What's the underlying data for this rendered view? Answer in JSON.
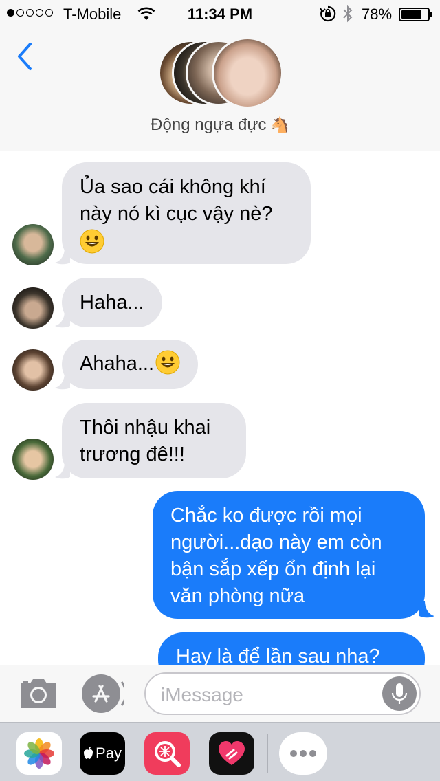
{
  "status_bar": {
    "carrier": "T-Mobile",
    "time": "11:34 PM",
    "battery": "78%",
    "signal_bars": 1,
    "battery_level": 0.78
  },
  "header": {
    "group_name": "Động ngựa đực",
    "group_emoji": "🐴"
  },
  "messages": [
    {
      "direction": "incoming",
      "text": "Ủa sao cái không khí\nnày nó kì cục vậy nè?",
      "emoji": "smiling-face"
    },
    {
      "direction": "incoming",
      "text": "Haha..."
    },
    {
      "direction": "incoming",
      "text": "Ahaha...",
      "emoji": "smiling-face"
    },
    {
      "direction": "incoming",
      "text": "Thôi nhậu khai\ntrương đê!!!"
    },
    {
      "direction": "outgoing",
      "text": "Chắc ko được rồi mọi\nngười...dạo này em còn\nbận sắp xếp ổn định lại\nvăn phòng nữa"
    },
    {
      "direction": "outgoing",
      "text": "Hay là để lần sau nha?"
    }
  ],
  "input": {
    "placeholder": "iMessage"
  },
  "app_drawer": {
    "apple_pay_label": "Pay",
    "apps": [
      "photos-icon",
      "apple-pay-icon",
      "search-images-icon",
      "digital-touch-icon",
      "more-icon"
    ]
  },
  "colors": {
    "incoming_bubble": "#e5e5ea",
    "outgoing_bubble": "#1a7cfa",
    "ios_blue": "#1a7cfa"
  }
}
